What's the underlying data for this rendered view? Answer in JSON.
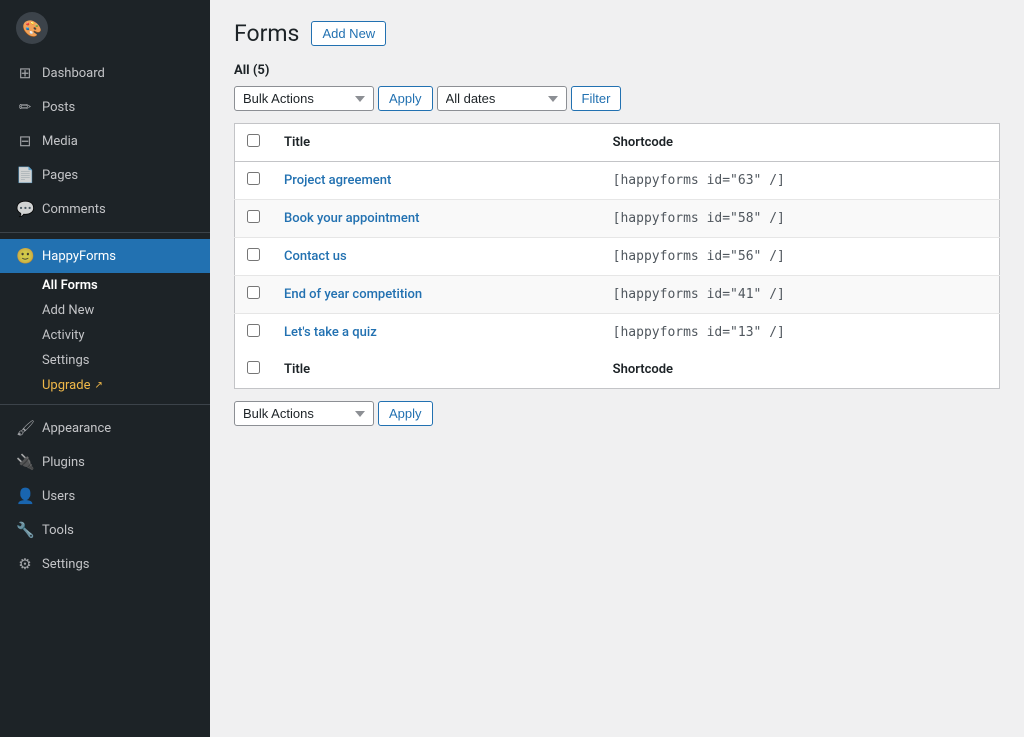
{
  "sidebar": {
    "logo": {
      "icon": "🎨",
      "label": ""
    },
    "items": [
      {
        "id": "dashboard",
        "label": "Dashboard",
        "icon": "⊞"
      },
      {
        "id": "posts",
        "label": "Posts",
        "icon": "✏"
      },
      {
        "id": "media",
        "label": "Media",
        "icon": "⊟"
      },
      {
        "id": "pages",
        "label": "Pages",
        "icon": "📄"
      },
      {
        "id": "comments",
        "label": "Comments",
        "icon": "💬"
      },
      {
        "id": "happyforms",
        "label": "HappyForms",
        "icon": "🙂",
        "active": true
      },
      {
        "id": "appearance",
        "label": "Appearance",
        "icon": "🖌"
      },
      {
        "id": "plugins",
        "label": "Plugins",
        "icon": "🔌"
      },
      {
        "id": "users",
        "label": "Users",
        "icon": "👤"
      },
      {
        "id": "tools",
        "label": "Tools",
        "icon": "🔧"
      },
      {
        "id": "settings",
        "label": "Settings",
        "icon": "⚙"
      }
    ],
    "submenu": [
      {
        "id": "all-forms",
        "label": "All Forms",
        "active": true
      },
      {
        "id": "add-new",
        "label": "Add New"
      },
      {
        "id": "activity",
        "label": "Activity"
      },
      {
        "id": "settings-sub",
        "label": "Settings"
      },
      {
        "id": "upgrade",
        "label": "Upgrade",
        "upgrade": true
      }
    ]
  },
  "page": {
    "title": "Forms",
    "add_new_label": "Add New",
    "count_label": "All",
    "count": "5",
    "bulk_actions_label": "Bulk Actions",
    "apply_label": "Apply",
    "all_dates_label": "All dates",
    "filter_label": "Filter",
    "table": {
      "col_title": "Title",
      "col_shortcode": "Shortcode",
      "rows": [
        {
          "title": "Project agreement",
          "shortcode": "[happyforms id=\"63\" /]"
        },
        {
          "title": "Book your appointment",
          "shortcode": "[happyforms id=\"58\" /]"
        },
        {
          "title": "Contact us",
          "shortcode": "[happyforms id=\"56\" /]"
        },
        {
          "title": "End of year competition",
          "shortcode": "[happyforms id=\"41\" /]"
        },
        {
          "title": "Let's take a quiz",
          "shortcode": "[happyforms id=\"13\" /]"
        }
      ]
    },
    "bottom_bulk_actions_label": "Bulk Actions",
    "bottom_apply_label": "Apply"
  }
}
